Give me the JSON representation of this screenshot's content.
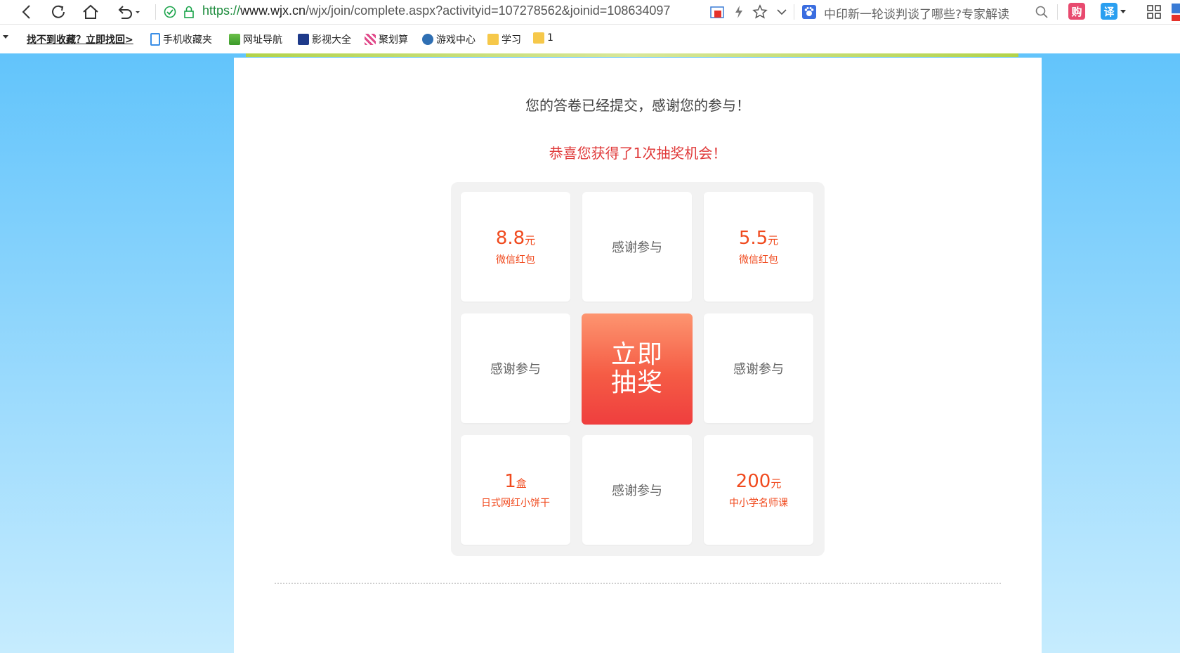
{
  "toolbar": {
    "url_scheme": "https://",
    "url_host": "www.wjx.cn",
    "url_path": "/wjx/join/complete.aspx?activityid=107278562&joinid=108634097",
    "search_text": "中印新一轮谈判谈了哪些?专家解读",
    "shop_chip": "购",
    "translate_chip": "译",
    "colors": {
      "secure_green": "#1a8a3a",
      "shop_red": "#e84a6f",
      "translate_blue": "#2a9ff0"
    }
  },
  "bookmarks": {
    "promo": "找不到收藏？立即找回>",
    "items": [
      {
        "label": "手机收藏夹",
        "icon": "phone-icon"
      },
      {
        "label": "网址导航",
        "icon": "nav-2345-icon"
      },
      {
        "label": "影视大全",
        "icon": "film-icon"
      },
      {
        "label": "聚划算",
        "icon": "ju-icon"
      },
      {
        "label": "游戏中心",
        "icon": "game-icon"
      },
      {
        "label": "学习",
        "icon": "folder-icon"
      },
      {
        "label": "1",
        "icon": "folder-icon"
      }
    ]
  },
  "page": {
    "thanks": "您的答卷已经提交，感谢您的参与！",
    "congrats": "恭喜您获得了1次抽奖机会！",
    "draw_button": "立即抽奖",
    "prizes": [
      {
        "amount": "8.8",
        "unit": "元",
        "desc": "微信红包"
      },
      {
        "none": "感谢参与"
      },
      {
        "amount": "5.5",
        "unit": "元",
        "desc": "微信红包"
      },
      {
        "none": "感谢参与"
      },
      {
        "none": "感谢参与"
      },
      {
        "amount": "1",
        "unit": "盒",
        "desc": "日式网红小饼干"
      },
      {
        "none": "感谢参与"
      },
      {
        "amount": "200",
        "unit": "元",
        "desc": "中小学名师课"
      }
    ]
  }
}
